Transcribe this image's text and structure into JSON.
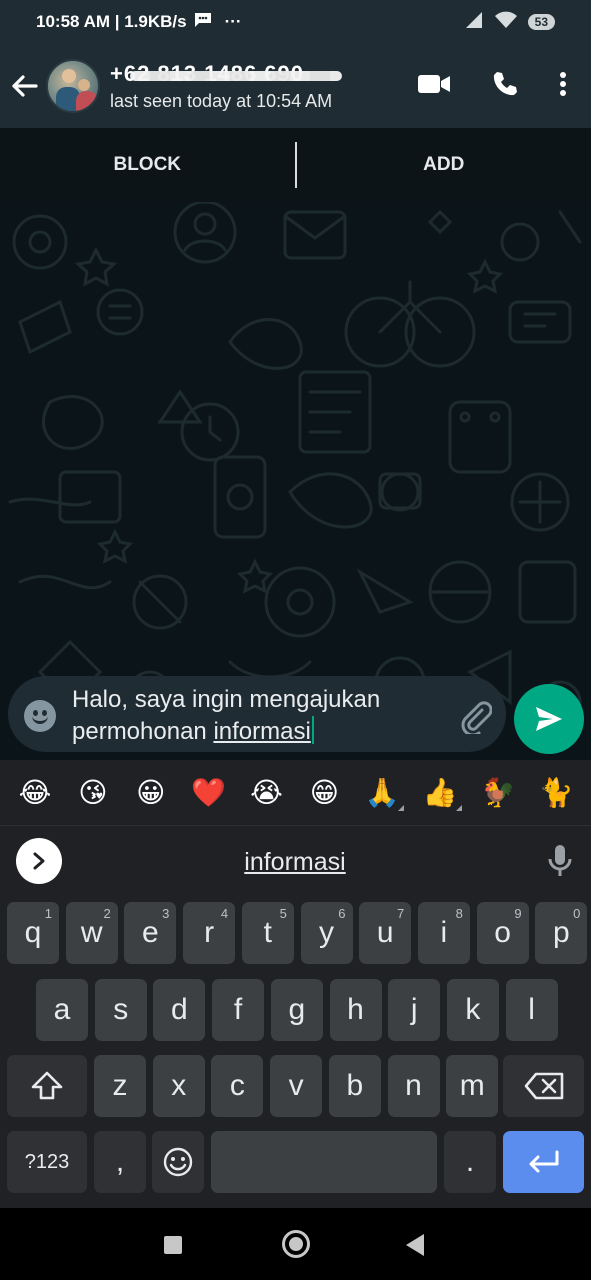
{
  "status_bar": {
    "time_speed": "10:58 AM | 1.9KB/s",
    "overflow_dots": "···",
    "battery": "53"
  },
  "header": {
    "contact_name": "+62 813 1486 690",
    "last_seen": "last seen today at 10:54 AM"
  },
  "block_bar": {
    "block_label": "BLOCK",
    "add_label": "ADD"
  },
  "composer": {
    "text_before": "Halo, saya ingin mengajukan permohonan ",
    "text_underlined": "informasi"
  },
  "keyboard": {
    "emojis": [
      "😂",
      "😘",
      "😀",
      "❤️",
      "😭",
      "😁",
      "🙏",
      "👍",
      "🐓",
      "🐈"
    ],
    "suggestion": "informasi",
    "row1": [
      {
        "k": "q",
        "n": "1"
      },
      {
        "k": "w",
        "n": "2"
      },
      {
        "k": "e",
        "n": "3"
      },
      {
        "k": "r",
        "n": "4"
      },
      {
        "k": "t",
        "n": "5"
      },
      {
        "k": "y",
        "n": "6"
      },
      {
        "k": "u",
        "n": "7"
      },
      {
        "k": "i",
        "n": "8"
      },
      {
        "k": "o",
        "n": "9"
      },
      {
        "k": "p",
        "n": "0"
      }
    ],
    "row2": [
      "a",
      "s",
      "d",
      "f",
      "g",
      "h",
      "j",
      "k",
      "l"
    ],
    "row3": [
      "z",
      "x",
      "c",
      "v",
      "b",
      "n",
      "m"
    ],
    "symbols_label": "?123",
    "comma": ",",
    "period": "."
  },
  "colors": {
    "accent": "#00a884",
    "header_bg": "#1f2c33",
    "enter_key": "#5b8def"
  }
}
